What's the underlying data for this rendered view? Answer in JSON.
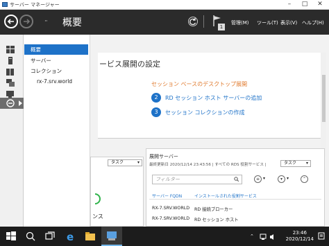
{
  "window": {
    "title": "サーバー マネージャー",
    "controls": [
      "minimize",
      "maximize",
      "close"
    ]
  },
  "header": {
    "title": "概要",
    "breadcrumb_separator": "··",
    "menus": [
      "管理(M)",
      "ツール(T)",
      "表示(V)",
      "ヘルプ(H)"
    ],
    "notification_count": "1"
  },
  "sidebar_icons": [
    "dashboard-icon",
    "local-server-icon",
    "all-servers-icon",
    "file-storage-icon",
    "rds-icon",
    "iis-icon"
  ],
  "nav": {
    "items": [
      {
        "label": "概要",
        "selected": true
      },
      {
        "label": "サーバー",
        "selected": false
      },
      {
        "label": "コレクション",
        "selected": false
      },
      {
        "label": "rx-7.srv.world",
        "selected": false
      }
    ]
  },
  "welcome": {
    "heading": "ービス展開の設定",
    "subheading": "セッション ベースのデスクトップ展開",
    "steps": [
      {
        "num": "2",
        "label": "RD セッション ホスト サーバーの追加"
      },
      {
        "num": "3",
        "label": "セッション コレクションの作成"
      }
    ]
  },
  "left_panel": {
    "task_label": "タスク",
    "fragment_text": "ンス"
  },
  "deploy_panel": {
    "title": "展開サーバー",
    "last_updated": "最終更新日 2020/12/14 23:43:56 | すべての RDS 役割サービス |",
    "task_label": "タスク",
    "filter_placeholder": "フィルター",
    "columns": [
      "サーバー FQDN",
      "インストールされた役割サービス"
    ],
    "rows": [
      [
        "RX-7.SRV.WORLD",
        "RD 接続ブローカー"
      ],
      [
        "RX-7.SRV.WORLD",
        "RD セッション ホスト"
      ]
    ]
  },
  "colors": {
    "accent": "#1e72c8",
    "orange": "#e07a2e",
    "header_bg": "#2b2b2b",
    "taskbar_bg": "#1c1c1c"
  },
  "taskbar": {
    "time": "23:46",
    "date": "2020/12/14"
  }
}
